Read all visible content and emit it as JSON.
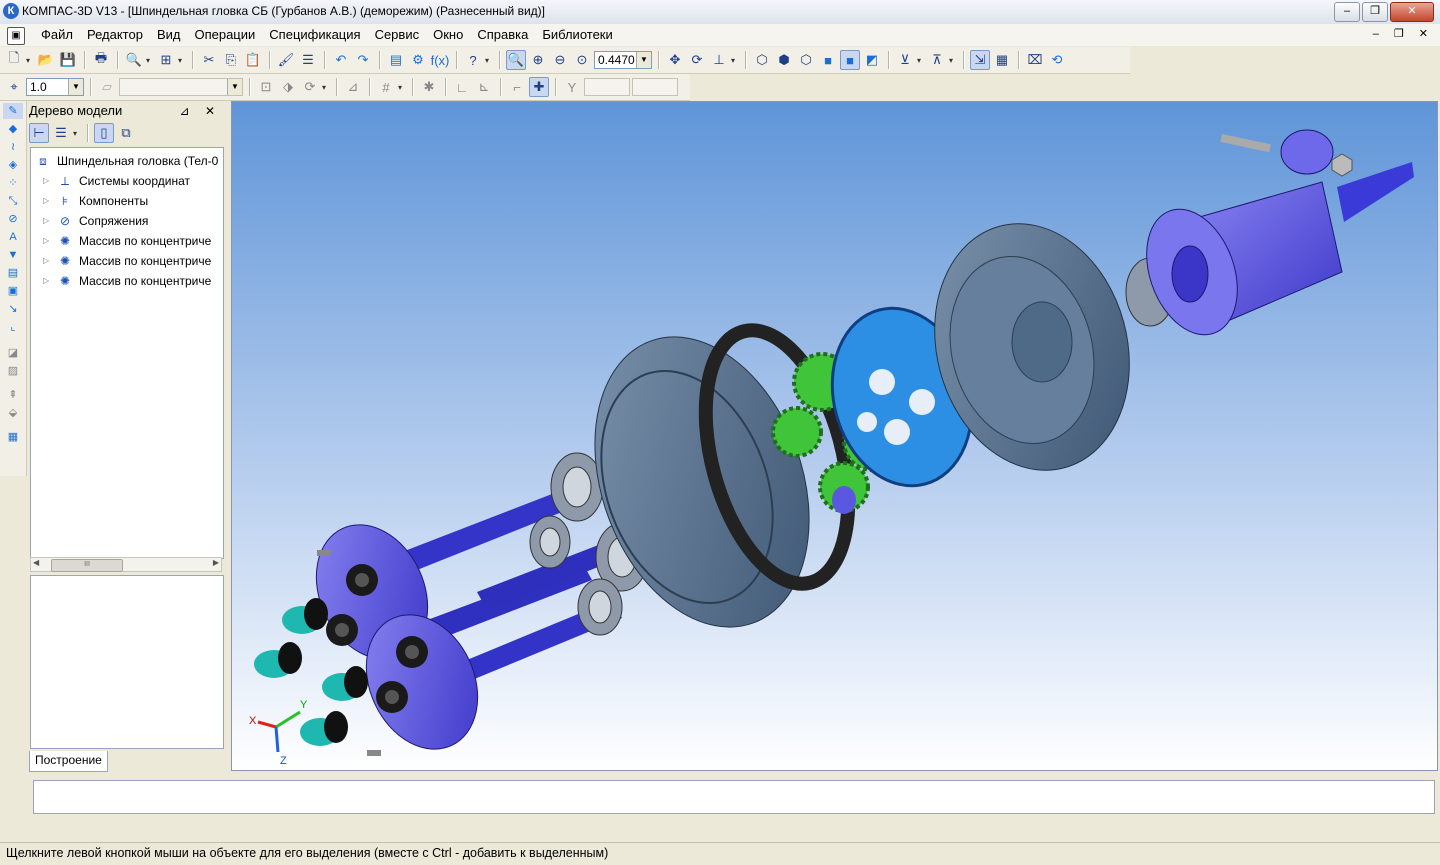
{
  "window": {
    "title": "КОМПАС-3D V13 - [Шпиндельная гловка СБ (Гурбанов А.В.) (деморежим) (Разнесенный вид)]",
    "app_icon": "К",
    "minimize": "‒",
    "maximize": "❐",
    "close": "✕"
  },
  "menu": {
    "items": [
      "Файл",
      "Редактор",
      "Вид",
      "Операции",
      "Спецификация",
      "Сервис",
      "Окно",
      "Справка",
      "Библиотеки"
    ],
    "mdi_controls": "‒ ❐ ✕"
  },
  "toolbar1": {
    "zoom_value": "0.4470"
  },
  "toolbar2": {
    "step_value": "1.0",
    "style_value": ""
  },
  "tree_panel": {
    "title": "Дерево модели",
    "pin": "⊿",
    "close": "✕",
    "root": "Шпиндельная головка (Тел-0",
    "nodes": [
      "Системы координат",
      "Компоненты",
      "Сопряжения",
      "Массив по концентриче",
      "Массив по концентриче",
      "Массив по концентриче"
    ],
    "scroll_grip": "III",
    "tab_label": "Построение"
  },
  "axes": {
    "x": "X",
    "y": "Y",
    "z": "Z"
  },
  "status": {
    "message": "Щелкните левой кнопкой мыши на объекте для его выделения (вместе с Ctrl - добавить к выделенным)"
  },
  "colors": {
    "viewport_top": "#5f95d8",
    "housing": "#4f6a86",
    "gear_green": "#3fc43a",
    "ring_gear": "#2d8fe4",
    "shaft_blue": "#3a3ad8",
    "cap_cyan": "#1fb8b0"
  }
}
